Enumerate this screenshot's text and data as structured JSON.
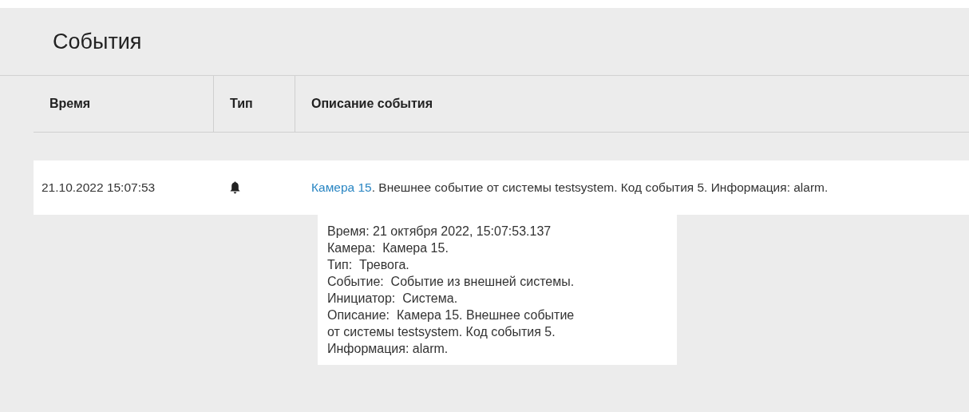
{
  "panel": {
    "title": "События"
  },
  "table": {
    "columns": [
      "Время",
      "Тип",
      "Описание события"
    ],
    "rows": [
      {
        "time": "21.10.2022 15:07:53",
        "kind": "alarm",
        "camera_link": "Камера 15",
        "description": ". Внешнее событие от системы testsystem. Код события 5. Информация: alarm."
      }
    ]
  },
  "tooltip": {
    "lines": [
      "Время: 21 октября 2022, 15:07:53.137",
      "Камера:  Камера 15.",
      "Тип:  Тревога.",
      "Событие:  Событие из внешней системы.",
      "Инициатор:  Система.",
      "Описание:  Камера 15. Внешнее событие",
      "от системы testsystem. Код события 5.",
      "Информация: alarm."
    ]
  }
}
